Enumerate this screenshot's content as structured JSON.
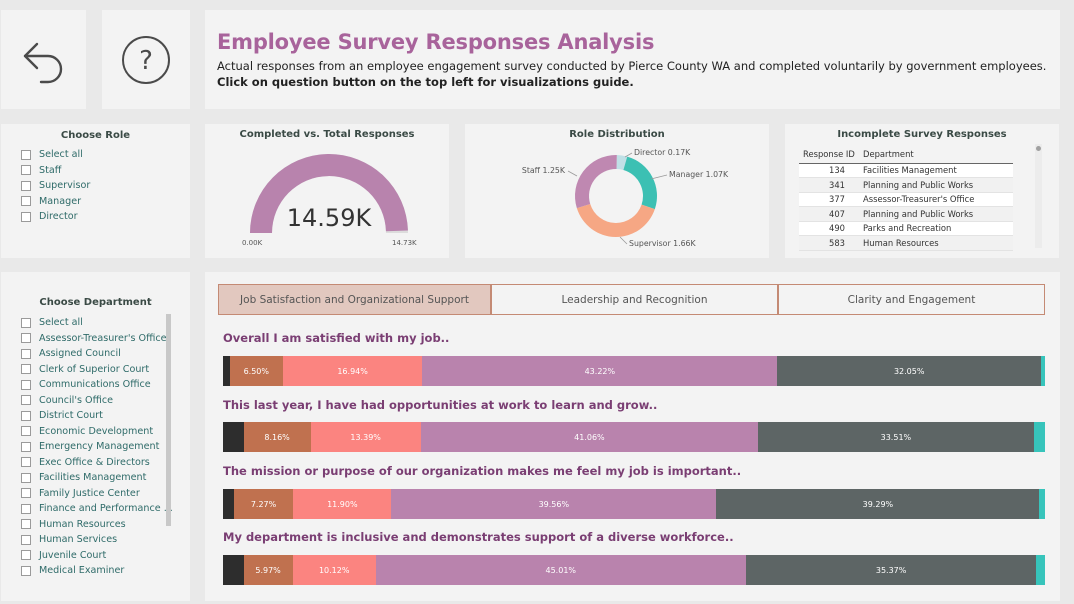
{
  "header": {
    "title": "Employee Survey Responses Analysis",
    "subtitle": "Actual responses from an employee engagement survey conducted by Pierce County WA and completed voluntarily by government employees.",
    "instruction": "Click on question button on the top left for visualizations guide."
  },
  "buttons": {
    "back_icon": "undo-arrow-icon",
    "help_icon": "question-mark-icon"
  },
  "role_slicer": {
    "title": "Choose Role",
    "items": [
      "Select all",
      "Staff",
      "Supervisor",
      "Manager",
      "Director"
    ]
  },
  "department_slicer": {
    "title": "Choose Department",
    "items": [
      "Select all",
      "Assessor-Treasurer's Office",
      "Assigned Council",
      "Clerk of Superior Court",
      "Communications Office",
      "Council's Office",
      "District Court",
      "Economic Development",
      "Emergency Management",
      "Exec Office & Directors",
      "Facilities Management",
      "Family Justice Center",
      "Finance and Performance ...",
      "Human Resources",
      "Human Services",
      "Juvenile Court",
      "Medical Examiner"
    ]
  },
  "gauge": {
    "title": "Completed vs. Total Responses",
    "value_label": "14.59K",
    "min_label": "0.00K",
    "max_label": "14.73K",
    "fill_fraction": 0.99
  },
  "donut": {
    "title": "Role Distribution",
    "slices": [
      {
        "name": "Director",
        "label": "Director 0.17K",
        "value": 0.17,
        "color": "#bfe0e6"
      },
      {
        "name": "Manager",
        "label": "Manager 1.07K",
        "value": 1.07,
        "color": "#3cc0b3"
      },
      {
        "name": "Supervisor",
        "label": "Supervisor 1.66K",
        "value": 1.66,
        "color": "#f6a784"
      },
      {
        "name": "Staff",
        "label": "Staff 1.25K",
        "value": 1.25,
        "color": "#bf88b1"
      }
    ]
  },
  "incomplete_table": {
    "title": "Incomplete Survey Responses",
    "columns": [
      "Response ID",
      "Department"
    ],
    "rows": [
      [
        "134",
        "Facilities Management"
      ],
      [
        "341",
        "Planning and Public Works"
      ],
      [
        "377",
        "Assessor-Treasurer's Office"
      ],
      [
        "407",
        "Planning and Public Works"
      ],
      [
        "490",
        "Parks and Recreation"
      ],
      [
        "583",
        "Human Resources"
      ]
    ]
  },
  "tabs": [
    {
      "label": "Job Satisfaction and Organizational Support",
      "active": true
    },
    {
      "label": "Leadership and Recognition",
      "active": false
    },
    {
      "label": "Clarity and Engagement",
      "active": false
    }
  ],
  "colors": {
    "strongly_disagree": "#2d2d2d",
    "disagree": "#c0714f",
    "neutral": "#fb8480",
    "agree": "#b983ad",
    "strongly_agree": "#5d6565",
    "no_answer": "#37c4bb"
  },
  "chart_data": {
    "type": "bar",
    "orientation": "horizontal-stacked-100",
    "categories": [
      "Overall I am satisfied with my job..",
      "This last year, I have had opportunities at work to learn and grow..",
      "The mission or purpose of our organization makes me feel my job is important..",
      "My department is inclusive and demonstrates support of a diverse workforce.."
    ],
    "series": [
      {
        "key": "strongly_disagree",
        "values": [
          0.8,
          2.5,
          1.3,
          2.5
        ],
        "labels": [
          "",
          "",
          "",
          ""
        ]
      },
      {
        "key": "disagree",
        "values": [
          6.5,
          8.16,
          7.27,
          5.97
        ],
        "labels": [
          "6.50%",
          "8.16%",
          "7.27%",
          "5.97%"
        ]
      },
      {
        "key": "neutral",
        "values": [
          16.94,
          13.39,
          11.9,
          10.12
        ],
        "labels": [
          "16.94%",
          "13.39%",
          "11.90%",
          "10.12%"
        ]
      },
      {
        "key": "agree",
        "values": [
          43.22,
          41.06,
          39.56,
          45.01
        ],
        "labels": [
          "43.22%",
          "41.06%",
          "39.56%",
          "45.01%"
        ]
      },
      {
        "key": "strongly_agree",
        "values": [
          32.05,
          33.51,
          39.29,
          35.37
        ],
        "labels": [
          "32.05%",
          "33.51%",
          "39.29%",
          "35.37%"
        ]
      },
      {
        "key": "no_answer",
        "values": [
          0.49,
          1.38,
          0.68,
          1.03
        ],
        "labels": [
          "",
          "",
          "",
          ""
        ]
      }
    ]
  }
}
